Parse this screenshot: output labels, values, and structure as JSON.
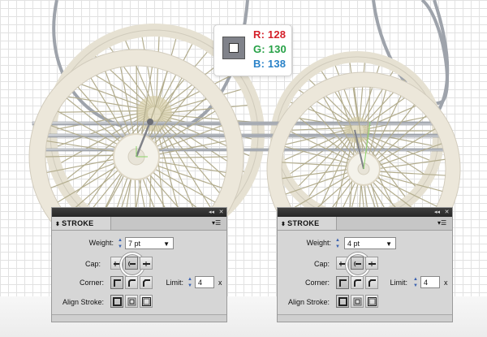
{
  "color_readout": {
    "r_label": "R: 128",
    "g_label": "G: 130",
    "b_label": "B: 138",
    "swatch_color": "#80828a"
  },
  "colors": {
    "wheel_cream": "#ebe6d8",
    "spoke": "#b3ad8e",
    "metal": "#9ea3ab"
  },
  "panels": [
    {
      "tab_label": "STROKE",
      "weight_label": "Weight:",
      "weight_value": "7 pt",
      "cap_label": "Cap:",
      "corner_label": "Corner:",
      "limit_label": "Limit:",
      "limit_value": "4",
      "limit_unit": "x",
      "align_label": "Align Stroke:"
    },
    {
      "tab_label": "STROKE",
      "weight_label": "Weight:",
      "weight_value": "4 pt",
      "cap_label": "Cap:",
      "corner_label": "Corner:",
      "limit_label": "Limit:",
      "limit_value": "4",
      "limit_unit": "x",
      "align_label": "Align Stroke:"
    }
  ]
}
